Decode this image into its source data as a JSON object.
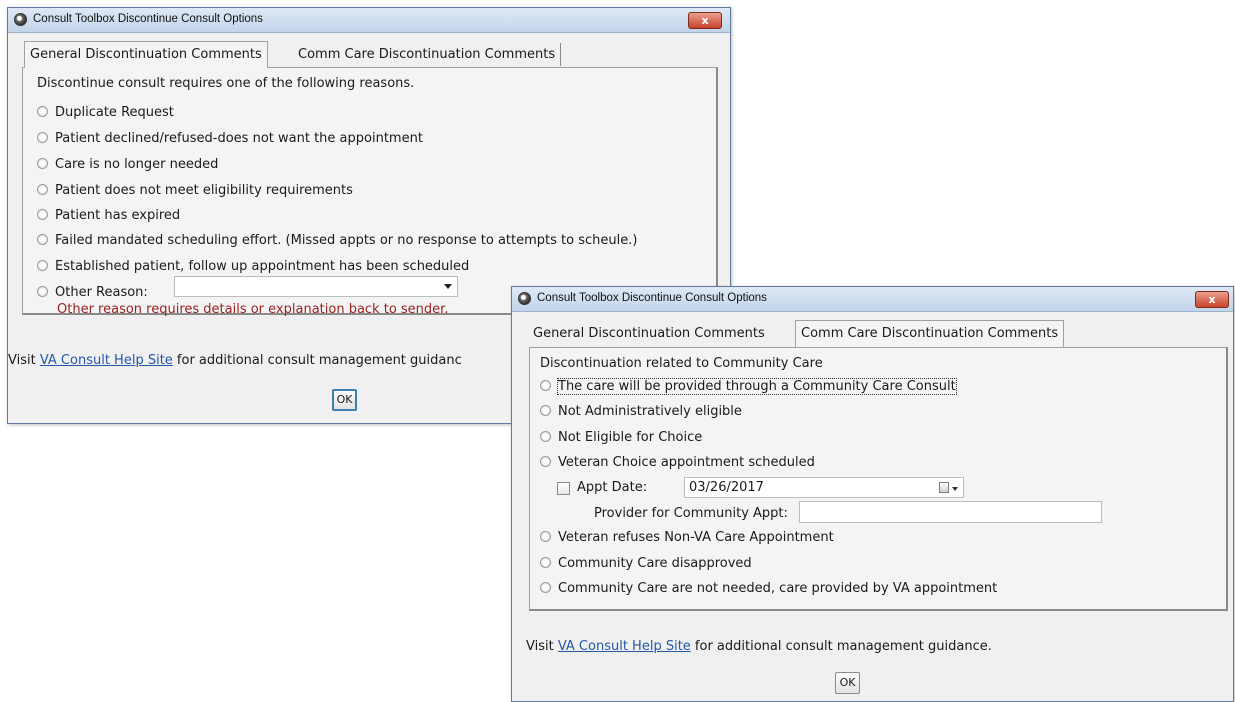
{
  "window1": {
    "title": "Consult Toolbox Discontinue Consult Options",
    "close_label": "x",
    "tabs": [
      {
        "label": "General Discontinuation Comments"
      },
      {
        "label": "Comm Care Discontinuation Comments"
      }
    ],
    "prompt": "Discontinue consult requires one of the following reasons.",
    "options": [
      "Duplicate Request",
      "Patient declined/refused-does not want the appointment",
      "Care is no longer needed",
      "Patient does not meet eligibility requirements",
      "Patient has expired",
      "Failed mandated scheduling effort. (Missed appts or no response to attempts to scheule.)",
      "Established patient, follow up appointment has been scheduled",
      "Other Reason:"
    ],
    "other_reason_value": "",
    "error_text": "Other reason requires details or explanation back to sender.",
    "footer_prefix": "Visit ",
    "footer_link": "VA Consult Help Site",
    "footer_suffix": " for additional consult management guidanc",
    "ok_label": "OK"
  },
  "window2": {
    "title": "Consult Toolbox Discontinue Consult Options",
    "close_label": "x",
    "tabs": [
      {
        "label": "General Discontinuation Comments"
      },
      {
        "label": "Comm Care Discontinuation Comments"
      }
    ],
    "prompt": "Discontinuation related to Community Care",
    "options_top": [
      "The care will be provided through a Community Care Consult",
      "Not Administratively eligible",
      "Not Eligible for Choice",
      "Veteran Choice appointment scheduled"
    ],
    "appt_date_label": "Appt Date:",
    "appt_date_value": "03/26/2017",
    "provider_label": "Provider for Community Appt:",
    "provider_value": "",
    "options_bottom": [
      "Veteran refuses Non-VA Care Appointment",
      "Community Care disapproved",
      "Community Care are not needed, care provided by VA appointment"
    ],
    "footer_prefix": "Visit ",
    "footer_link": "VA Consult Help Site",
    "footer_suffix": " for additional consult management guidance.",
    "ok_label": "OK"
  },
  "colors": {
    "error_text": "#9b2222",
    "link": "#2457a8",
    "close_button": "#c7432a",
    "default_button_border": "#3c7fb1"
  },
  "icons": [
    "app-icon",
    "close-icon",
    "calendar-icon",
    "dropdown-arrow-icon"
  ]
}
